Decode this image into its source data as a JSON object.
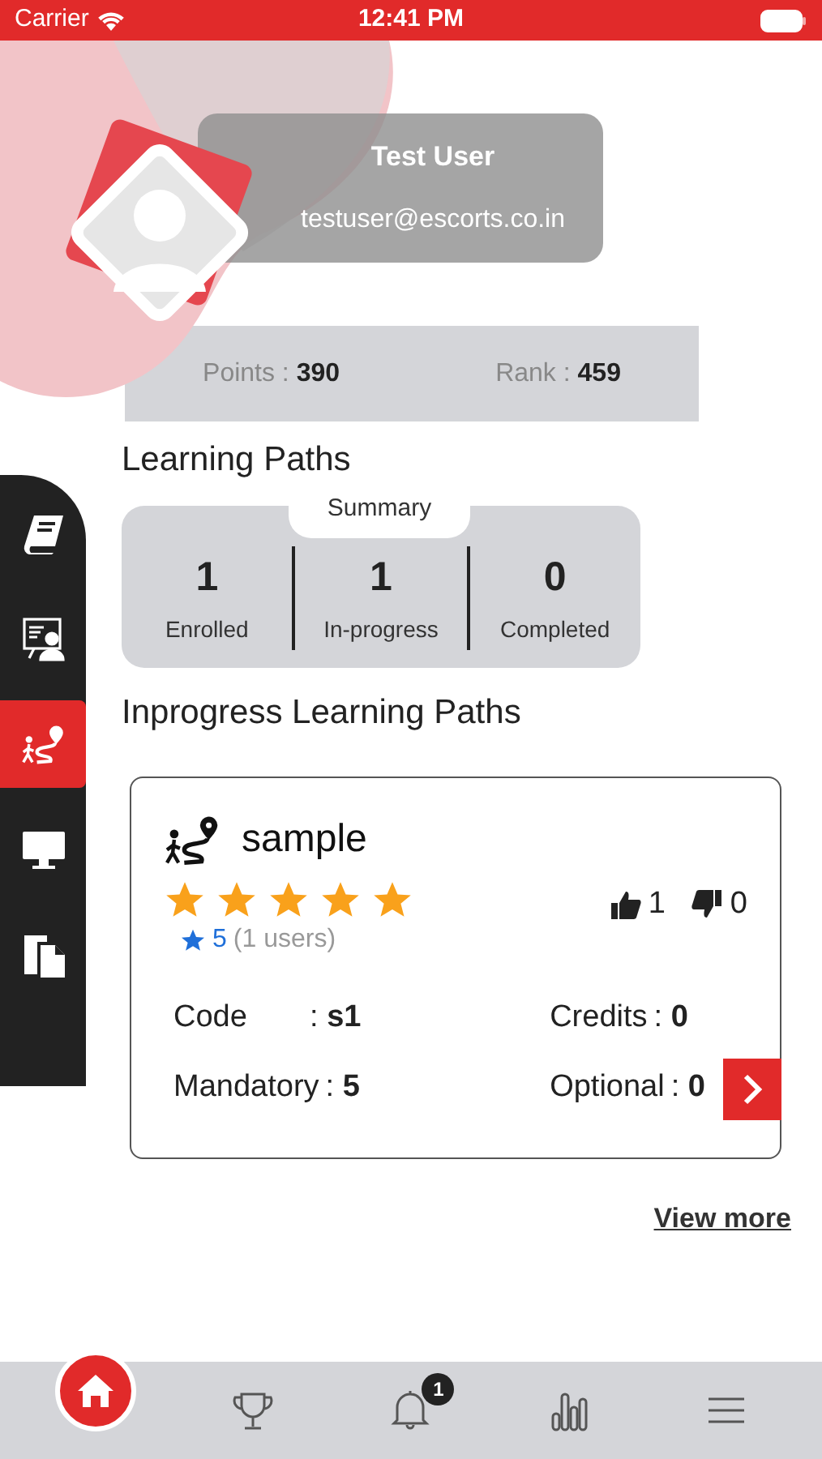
{
  "status_bar": {
    "carrier": "Carrier",
    "time": "12:41 PM"
  },
  "profile": {
    "name": "Test User",
    "email": "testuser@escorts.co.in"
  },
  "stats": [
    {
      "text": "Points : **390**"
    },
    {
      "text": "Rank : **459**"
    }
  ],
  "learning_paths": {
    "title": "Learning Paths",
    "summary_label": "Summary",
    "summary": [
      {
        "value": "1",
        "label": "Enrolled"
      },
      {
        "value": "1",
        "label": "In-progress"
      },
      {
        "value": "0",
        "label": "Completed"
      }
    ]
  },
  "inprogress_title": "Inprogress Learning Paths",
  "courses": [
    {
      "title": "sample",
      "stars": 5,
      "rating": "5",
      "users": "(1 users)",
      "likes": "1",
      "dislikes": "0",
      "fields": [
        {
          "label": "Code",
          "value": ": **s1**"
        },
        {
          "label": "Credits",
          "value": ": **0**"
        },
        {
          "label": "Mandatory",
          "value": ": **5**"
        },
        {
          "label": "Optional",
          "value": ": **0**"
        }
      ]
    }
  ],
  "view_more": "View more",
  "side_nav": [
    {
      "kind": "book",
      "selected": false
    },
    {
      "kind": "presentation",
      "selected": false
    },
    {
      "kind": "path",
      "selected": true
    },
    {
      "kind": "monitor",
      "selected": false
    },
    {
      "kind": "documents",
      "selected": false
    }
  ],
  "bottom_nav": [
    {
      "kind": "home",
      "selected": true
    },
    {
      "kind": "trophy",
      "selected": false
    },
    {
      "kind": "bell",
      "selected": false,
      "badge": "1"
    },
    {
      "kind": "chart",
      "selected": false
    },
    {
      "kind": "menu",
      "selected": false
    }
  ]
}
